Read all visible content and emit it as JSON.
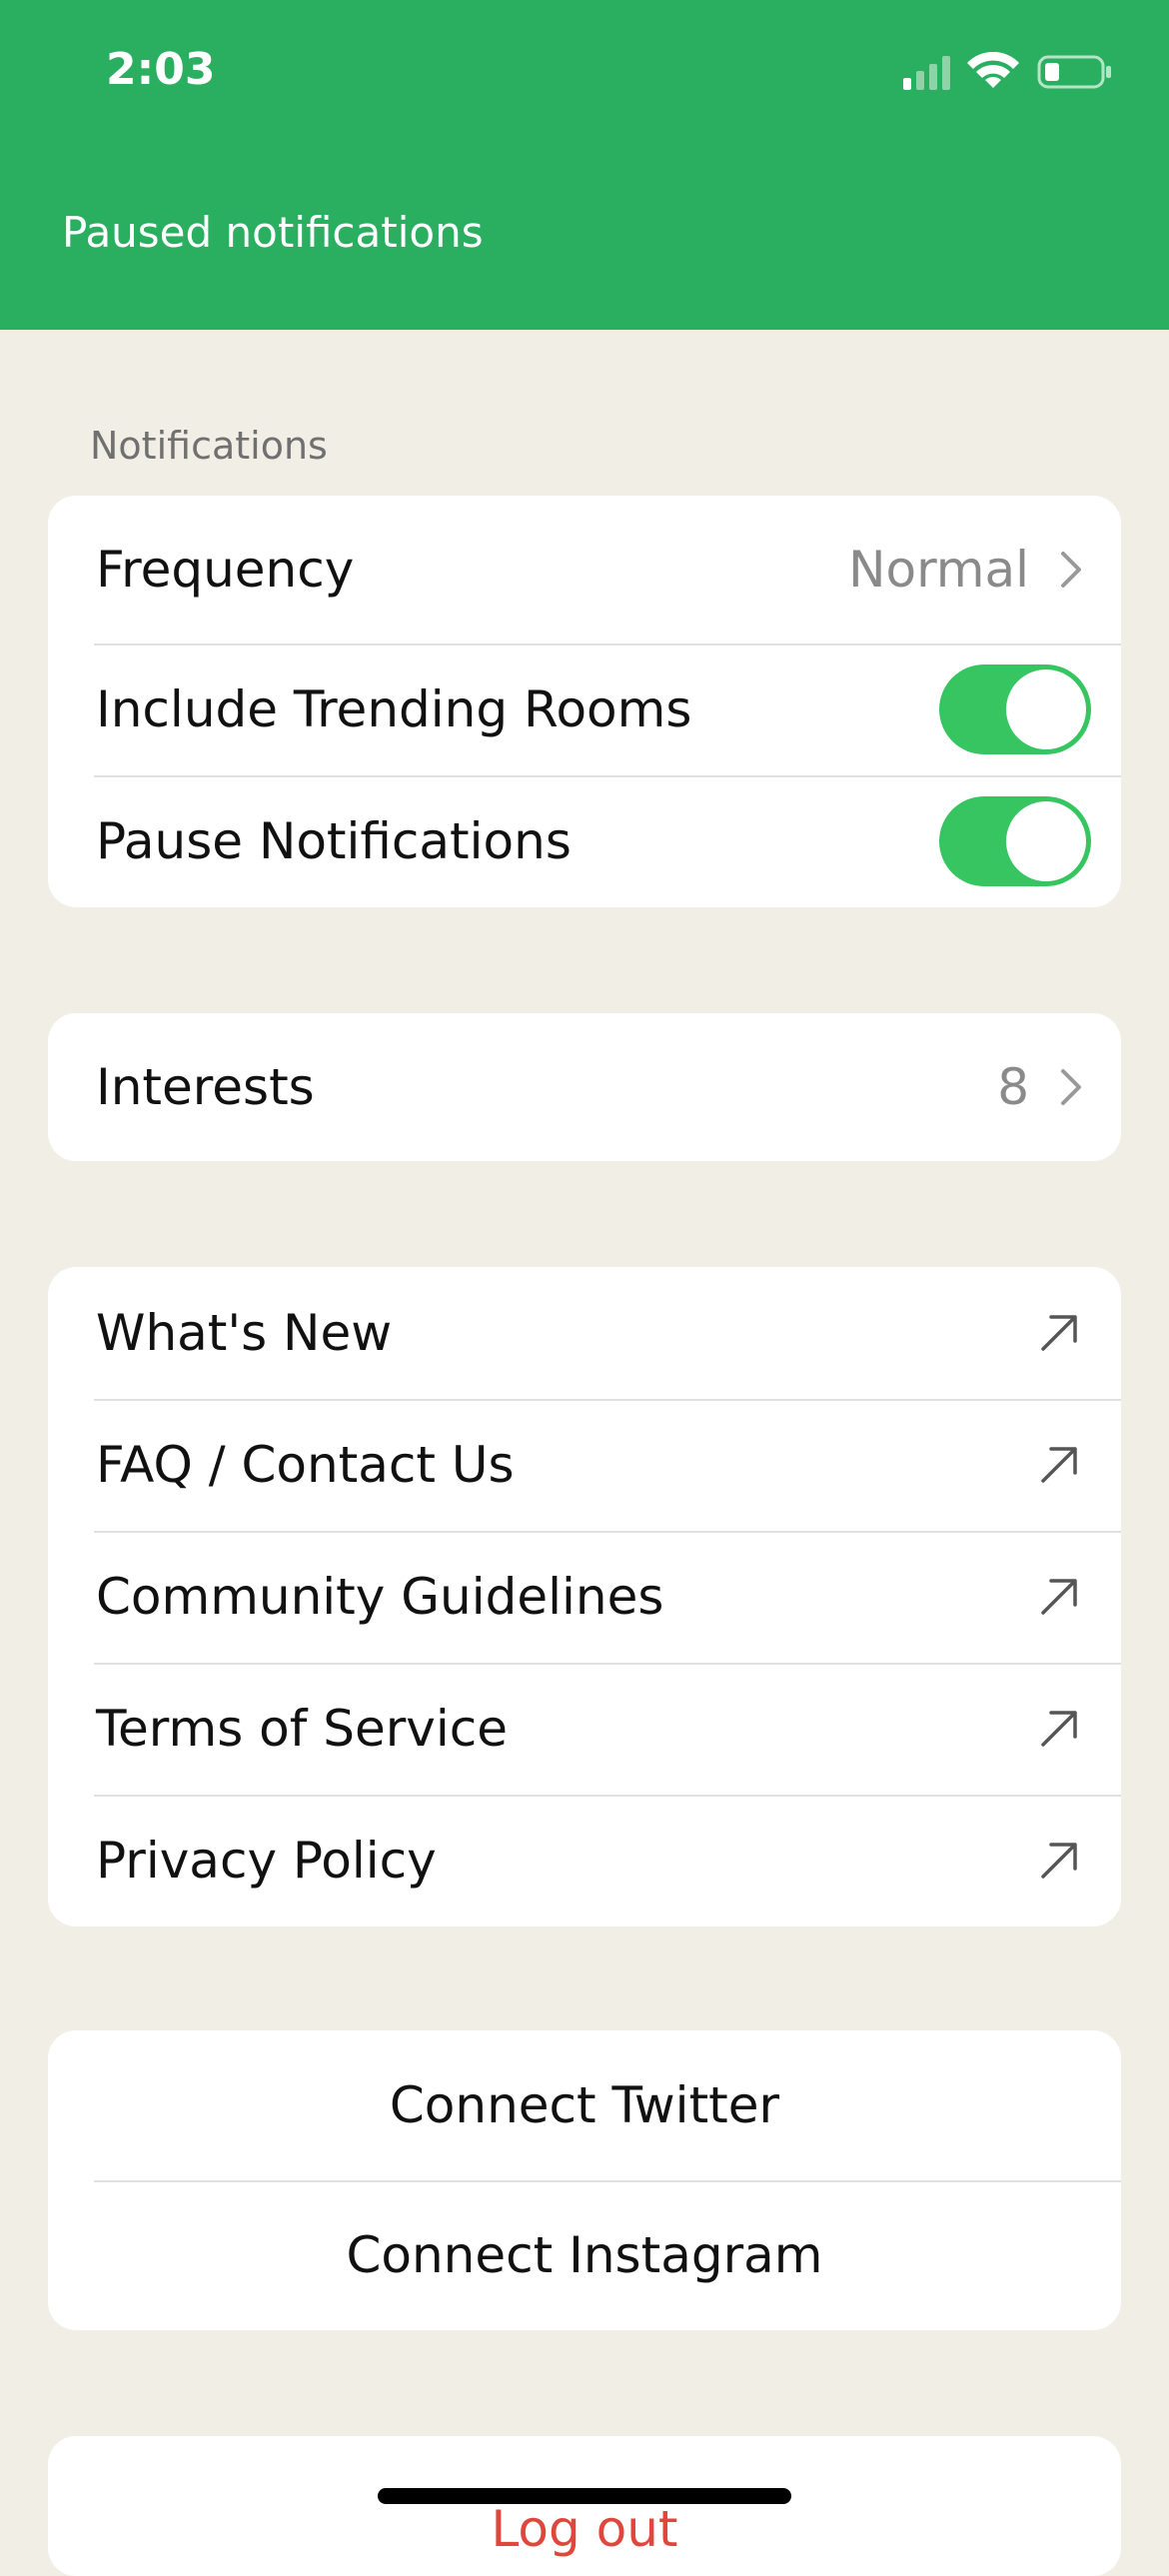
{
  "status_bar": {
    "time": "2:03",
    "icons": [
      "cellular-signal-icon",
      "wifi-icon",
      "battery-icon"
    ]
  },
  "header": {
    "banner": "Paused notifications",
    "color": "#2aae60"
  },
  "notifications": {
    "section_label": "Notifications",
    "frequency": {
      "label": "Frequency",
      "value": "Normal"
    },
    "include_trending": {
      "label": "Include Trending Rooms",
      "on": true
    },
    "pause_notifications": {
      "label": "Pause Notifications",
      "on": true
    }
  },
  "interests": {
    "label": "Interests",
    "value": "8"
  },
  "links": [
    {
      "label": "What's New"
    },
    {
      "label": "FAQ / Contact Us"
    },
    {
      "label": "Community Guidelines"
    },
    {
      "label": "Terms of Service"
    },
    {
      "label": "Privacy Policy"
    }
  ],
  "connect": {
    "twitter": "Connect Twitter",
    "instagram": "Connect Instagram"
  },
  "logout": {
    "label": "Log out",
    "color": "#e0473c"
  },
  "colors": {
    "background": "#f1efe5",
    "toggle_on": "#36c560"
  }
}
